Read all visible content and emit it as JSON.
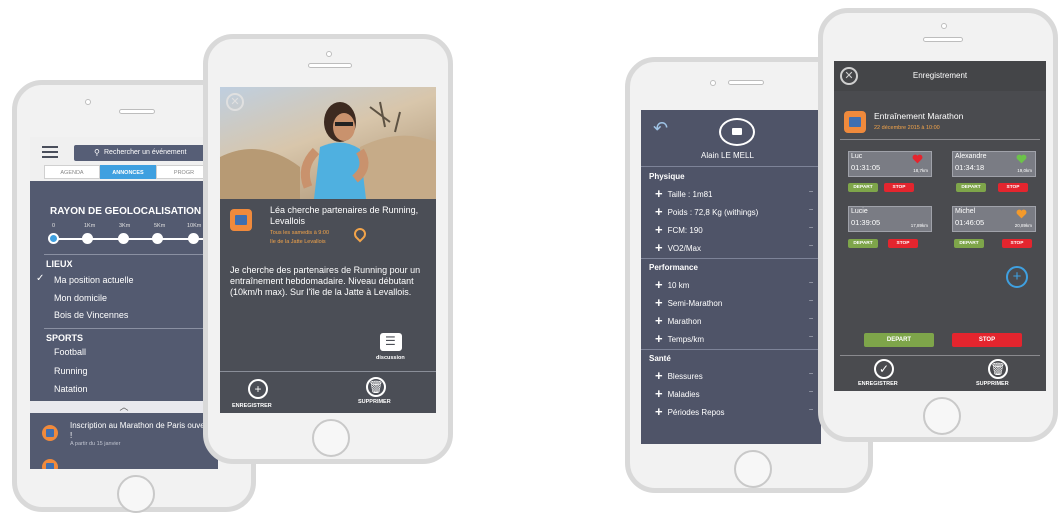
{
  "phone1": {
    "search_placeholder": "Rechercher un événement",
    "tabs": [
      "AGENDA",
      "ANNONCES",
      "PROGR"
    ],
    "geo_title": "RAYON DE GEOLOCALISATION",
    "km_labels": [
      "0",
      "1Km",
      "3Km",
      "5Km",
      "10Km"
    ],
    "lieux_title": "LIEUX",
    "lieux": [
      "Ma position actuelle",
      "Mon domicile",
      "Bois de Vincennes"
    ],
    "sports_title": "SPORTS",
    "sports": [
      "Football",
      "Running",
      "Natation"
    ],
    "news_title": "Inscription au Marathon de Paris ouvertes !",
    "news_subtitle": "A partir du 15 janvier",
    "colors": {
      "accent": "#3fa0e0",
      "panel": "#535a70"
    }
  },
  "phone2": {
    "annonce_title": "Léa cherche partenaires de Running, Levallois",
    "schedule": "Tous les samedis à 9:00",
    "place": "Ile de la Jatte Levallois",
    "description": "Je cherche des partenaires de Running pour un entraînement hebdomadaire. Niveau débutant (10km/h max). Sur l'île de la Jatte à Levallois.",
    "discussion_label": "discussion",
    "save_label": "ENREGISTRER",
    "delete_label": "SUPPRIMER",
    "colors": {
      "orange": "#f3a44a"
    }
  },
  "phone3": {
    "user_name": "Alain LE MELL",
    "sections": [
      {
        "title": "Physique",
        "rows": [
          "Taille : 1m81",
          "Poids : 72,8 Kg (withings)",
          "FCM: 190",
          "VO2/Max"
        ]
      },
      {
        "title": "Performance",
        "rows": [
          "10 km",
          "Semi-Marathon",
          "Marathon",
          "Temps/km"
        ]
      },
      {
        "title": "Santé",
        "rows": [
          "Blessures",
          "Maladies",
          "Périodes Repos"
        ]
      }
    ],
    "row_dash": "–"
  },
  "phone4": {
    "title": "Enregistrement",
    "race_title": "Entraînement Marathon",
    "race_date": "22 décembre 2015 à 10:00",
    "runners": [
      {
        "name": "Luc",
        "time": "01:31:05",
        "dist": "18,7km",
        "heart_color": "#e4252e"
      },
      {
        "name": "Alexandre",
        "time": "01:34:18",
        "dist": "19,0km",
        "heart_color": "#6cc24a"
      },
      {
        "name": "Lucie",
        "time": "01:39:05",
        "dist": "17,89km",
        "heart_color": ""
      },
      {
        "name": "Michel",
        "time": "01:46:05",
        "dist": "20,89km",
        "heart_color": "#f39a2c"
      }
    ],
    "depart_label": "DEPART",
    "stop_label": "STOP",
    "save_label": "ENREGISTRER",
    "delete_label": "SUPPRIMER"
  }
}
